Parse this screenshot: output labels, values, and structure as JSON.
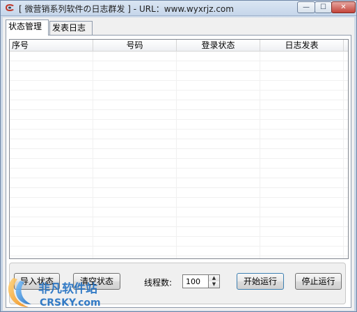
{
  "window": {
    "title": "[ 微营销系列软件の日志群发 ] - URL：www.wyxrjz.com",
    "controls": {
      "minimize": "—",
      "maximize": "☐",
      "close": "✕"
    }
  },
  "tabs": [
    {
      "label": "状态管理",
      "active": true
    },
    {
      "label": "发表日志",
      "active": false
    }
  ],
  "list": {
    "columns": [
      "序号",
      "号码",
      "登录状态",
      "日志发表"
    ],
    "rows": []
  },
  "controls": {
    "import_label": "导入状态",
    "clear_label": "清空状态",
    "threads_label": "线程数:",
    "threads_value": "100",
    "start_label": "开始运行",
    "stop_label": "停止运行"
  },
  "watermark": {
    "brand_cn": "非凡软件站",
    "brand_en": "CRSKY.com",
    "colors": {
      "orange": "#f39a1e",
      "blue": "#1f6fc2"
    }
  },
  "icons": {
    "app": "app-logo-icon",
    "spin_up": "arrow-up-icon",
    "spin_down": "arrow-down-icon"
  }
}
